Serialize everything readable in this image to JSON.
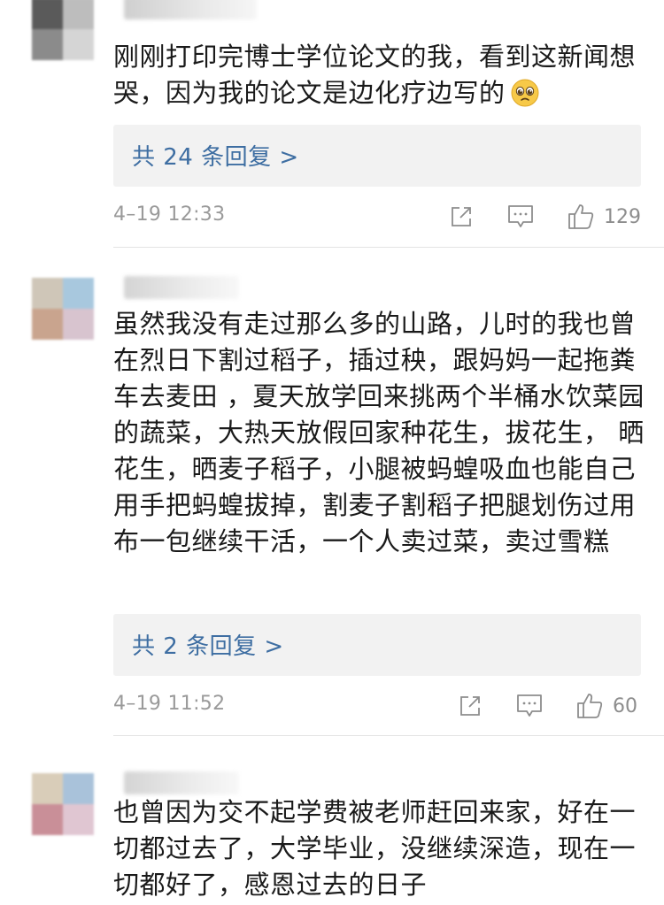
{
  "colors": {
    "text": "#1a1a1a",
    "link": "#3e6ea2",
    "muted": "#9a9a9a",
    "reply_bg": "#f2f2f2"
  },
  "comments": [
    {
      "text": "刚刚打印完博士学位论文的我，看到这新闻想哭，因为我的论文是边化疗边写的",
      "emoji": "pleading-face-emoji",
      "reply_label": "共 24 条回复 >",
      "timestamp": "4–19 12:33",
      "likes": "129"
    },
    {
      "text": "虽然我没有走过那么多的山路，儿时的我也曾在烈日下割过稻子，插过秧，跟妈妈一起拖粪车去麦田 ，夏天放学回来挑两个半桶水饮菜园的蔬菜，大热天放假回家种花生，拔花生， 晒花生，晒麦子稻子，小腿被蚂蝗吸血也能自己用手把蚂蝗拔掉，割麦子割稻子把腿划伤过用布一包继续干活，一个人卖过菜，卖过雪糕",
      "reply_label": "共 2 条回复 >",
      "timestamp": "4–19 11:52",
      "likes": "60"
    },
    {
      "text": "也曾因为交不起学费被老师赶回来家，好在一切都过去了，大学毕业，没继续深造，现在一切都好了，感恩过去的日子"
    }
  ],
  "icons": {
    "share": "share-icon",
    "comment": "comment-icon",
    "like": "thumbs-up-icon"
  }
}
